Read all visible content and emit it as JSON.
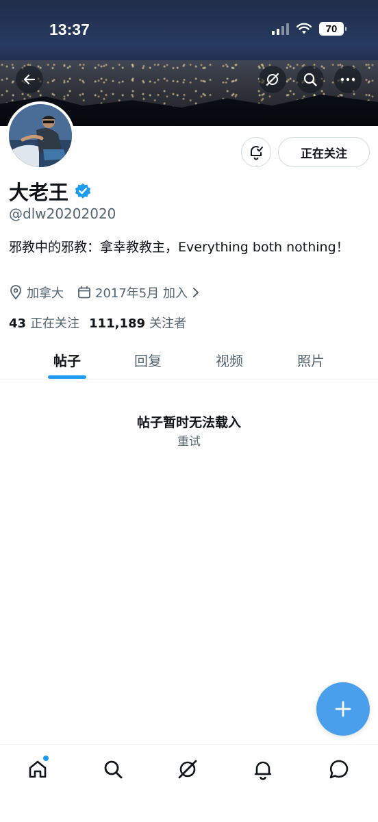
{
  "status_bar": {
    "time": "13:37",
    "battery": "70"
  },
  "profile": {
    "display_name": "大老王",
    "handle": "@dlw20202020",
    "bio": "邪教中的邪教：拿幸教教主，Everything both nothing！",
    "location": "加拿大",
    "joined": "2017年5月 加入",
    "following_count": "43",
    "following_label": "正在关注",
    "followers_count": "111,189",
    "followers_label": "关注者"
  },
  "actions": {
    "following_button": "正在关注"
  },
  "tabs": [
    {
      "label": "帖子",
      "active": true
    },
    {
      "label": "回复",
      "active": false
    },
    {
      "label": "视频",
      "active": false
    },
    {
      "label": "照片",
      "active": false
    }
  ],
  "empty_state": {
    "title": "帖子暂时无法载入",
    "retry": "重试"
  },
  "colors": {
    "accent": "#1d9bf0",
    "fab": "#4a9fec",
    "verified": "#1d9bf0"
  },
  "icons": {
    "header": [
      "back-arrow-icon",
      "grok-icon",
      "search-icon",
      "more-icon"
    ],
    "bottom_nav": [
      "home-icon",
      "search-icon",
      "grok-icon",
      "bell-icon",
      "message-icon"
    ]
  }
}
